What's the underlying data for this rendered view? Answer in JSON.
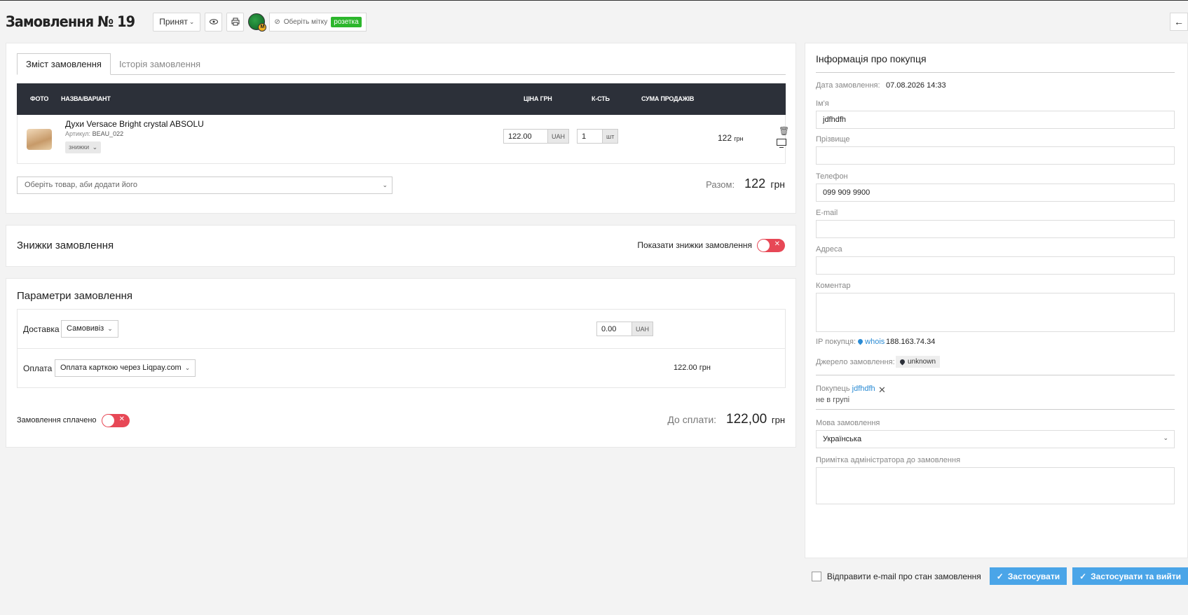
{
  "header": {
    "title": "Замовлення № 19",
    "status_label": "Принят",
    "tag_placeholder": "Оберіть мітку",
    "tag_badge": "розетка"
  },
  "tabs": [
    {
      "label": "Зміст замовлення",
      "active": true
    },
    {
      "label": "Історія замовлення",
      "active": false
    }
  ],
  "table": {
    "columns": [
      "ФОТО",
      "НАЗВА/ВАРІАНТ",
      "ЦІНА ГРН",
      "К-СТЬ",
      "СУМА ПРОДАЖІВ"
    ],
    "rows": [
      {
        "name": "Духи Versace Bright crystal ABSOLU",
        "sku_label": "Артикул:",
        "sku": "BEAU_022",
        "discount_label": "знижки",
        "price": "122.00",
        "price_unit": "UAH",
        "qty": "1",
        "qty_unit": "шт",
        "sum": "122",
        "sum_unit": "грн"
      }
    ]
  },
  "add_product": {
    "placeholder": "Оберіть товар, аби додати його"
  },
  "total": {
    "label": "Разом:",
    "value": "122",
    "currency": "грн"
  },
  "discounts": {
    "title": "Знижки замовлення",
    "toggle_label": "Показати знижки замовлення"
  },
  "params": {
    "title": "Параметри замовлення",
    "delivery_label": "Доставка",
    "delivery_value": "Самовивіз",
    "delivery_price": "0.00",
    "delivery_unit": "UAH",
    "payment_label": "Оплата",
    "payment_value": "Оплата карткою через Liqpay.com",
    "payment_amount": "122.00 грн",
    "paid_label": "Замовлення сплачено",
    "to_pay_label": "До сплати:",
    "to_pay_value": "122,00",
    "to_pay_currency": "грн"
  },
  "buyer": {
    "title": "Інформація про покупця",
    "date_label": "Дата замовлення:",
    "date_value": "07.08.2026 14:33",
    "name_label": "Ім'я",
    "name_value": "jdfhdfh",
    "surname_label": "Прізвище",
    "surname_value": "",
    "phone_label": "Телефон",
    "phone_value": "099 909 9900",
    "email_label": "E-mail",
    "email_value": "",
    "address_label": "Адреса",
    "address_value": "",
    "comment_label": "Коментар",
    "ip_label": "IP покупця:",
    "whois_label": "whois",
    "ip_value": "188.163.74.34",
    "source_label": "Джерело замовлення:",
    "source_value": "unknown",
    "customer_prefix": "Покупець",
    "customer_name": "jdfhdfh",
    "customer_group": "не в групі",
    "language_label": "Мова замовлення",
    "language_value": "Українська",
    "admin_note_label": "Примітка адміністратора до замовлення"
  },
  "footer": {
    "email_checkbox_label": "Відправити e-mail про стан замовлення",
    "apply_label": "Застосувати",
    "apply_exit_label": "Застосувати та вийти"
  },
  "colors": {
    "accent": "#4aa5e8",
    "toggle_off": "#e74856",
    "table_header": "#2c3039",
    "tag_green": "#2cb62c"
  }
}
